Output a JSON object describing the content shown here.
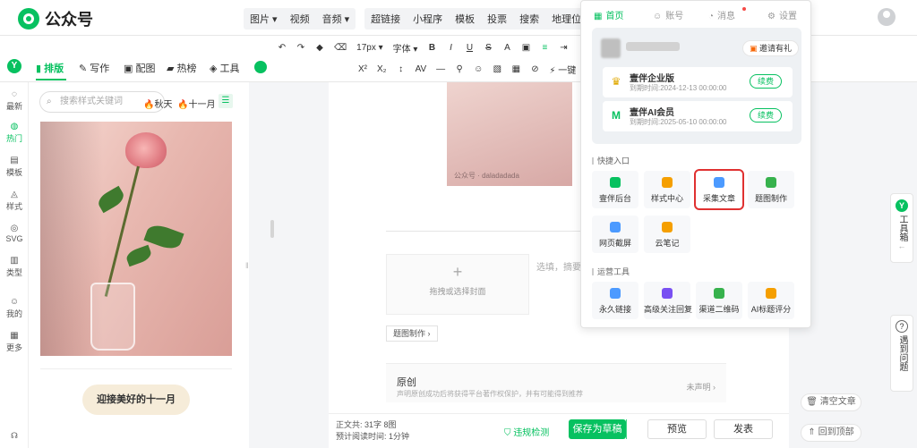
{
  "app": {
    "name": "公众号"
  },
  "insert_menu": {
    "group1": [
      "图片",
      "视频",
      "音频"
    ],
    "group2": [
      "超链接",
      "小程序",
      "模板",
      "投票",
      "搜索",
      "地理位置"
    ]
  },
  "toolbar": {
    "font_size": "17px",
    "font_family": "字体",
    "row1_icons": [
      "undo-icon",
      "redo-icon",
      "format-painter-icon",
      "eraser-icon"
    ],
    "one_click_label": "一键"
  },
  "left_tabs": [
    {
      "label": "排版",
      "icon": "layout-icon",
      "active": true
    },
    {
      "label": "写作",
      "icon": "pen-icon",
      "active": false
    },
    {
      "label": "配图",
      "icon": "image-icon",
      "active": false
    },
    {
      "label": "热榜",
      "icon": "hot-list-icon",
      "active": false
    },
    {
      "label": "工具",
      "icon": "tools-icon",
      "active": false
    }
  ],
  "side_rail": [
    {
      "label": "最新",
      "icon": "latest-icon"
    },
    {
      "label": "热门",
      "icon": "hot-icon",
      "active": true
    },
    {
      "label": "模板",
      "icon": "template-icon"
    },
    {
      "label": "样式",
      "icon": "style-icon"
    },
    {
      "label": "SVG",
      "icon": "svg-icon"
    },
    {
      "label": "类型",
      "icon": "type-icon"
    },
    {
      "label": "我的",
      "icon": "my-icon"
    },
    {
      "label": "更多",
      "icon": "more-icon"
    }
  ],
  "style_panel": {
    "search_placeholder": "搜索样式关键词",
    "tags": [
      "秋天",
      "十一月"
    ],
    "banner_text": "迎接美好的十一月"
  },
  "editor": {
    "image_caption": "公众号 · daladadada",
    "cover_hint": "拖拽或选择封面",
    "abstract_placeholder": "选填，摘要",
    "tutu_button": "题图制作",
    "original": {
      "title": "原创",
      "desc": "声明原创成功后将获得平台著作权保护，并有可能得到推荐",
      "status": "未声明"
    }
  },
  "bottom_bar": {
    "word_count_label": "正文共:",
    "word_count_value": "31字 8图",
    "read_time_label": "预计阅读时间:",
    "read_time_value": "1分钟",
    "check_label": "违规检测",
    "save_label": "保存为草稿",
    "preview_label": "预览",
    "publish_label": "发表"
  },
  "float_buttons": {
    "clear": "清空文章",
    "back_top": "回到顶部"
  },
  "side_widgets": {
    "toolbox": "工具箱",
    "problem": "遇到问题"
  },
  "popover": {
    "nav": [
      {
        "label": "首页",
        "icon": "home-grid-icon",
        "active": true
      },
      {
        "label": "账号",
        "icon": "user-icon"
      },
      {
        "label": "消息",
        "icon": "message-icon"
      },
      {
        "label": "设置",
        "icon": "gear-icon"
      }
    ],
    "invite_label": "邀请有礼",
    "members": [
      {
        "title": "壹伴企业版",
        "date": "到期时间:2024-12-13 00:00:00",
        "renew": "续费",
        "icon": "crown-icon"
      },
      {
        "title": "壹伴AI会员",
        "date": "到期时间:2025-05-10 00:00:00",
        "renew": "续费",
        "icon": "ai-icon"
      }
    ],
    "quick_title": "快捷入口",
    "quick": [
      {
        "label": "壹伴后台",
        "color": "#07c160"
      },
      {
        "label": "样式中心",
        "color": "#f59f00"
      },
      {
        "label": "采集文章",
        "color": "#4c9aff",
        "highlight": true
      },
      {
        "label": "题图制作",
        "color": "#37b24d"
      },
      {
        "label": "网页截屏",
        "color": "#4c9aff"
      },
      {
        "label": "云笔记",
        "color": "#f59f00"
      }
    ],
    "ops_title": "运营工具",
    "ops": [
      {
        "label": "永久链接",
        "color": "#4c9aff"
      },
      {
        "label": "高级关注回复",
        "color": "#7950f2"
      },
      {
        "label": "渠道二维码",
        "color": "#37b24d"
      },
      {
        "label": "AI标题评分",
        "color": "#f59f00"
      }
    ]
  }
}
